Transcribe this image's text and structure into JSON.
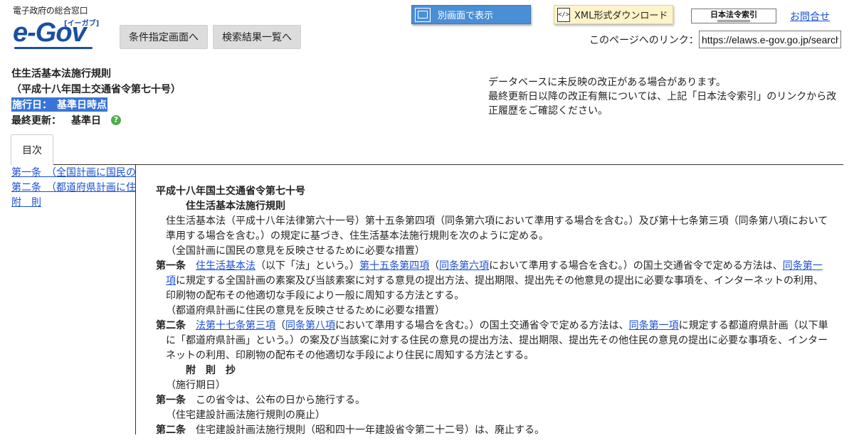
{
  "header": {
    "logo_sub": "電子政府の総合窓口",
    "logo_text": "e-Gov",
    "logo_ruby": "[イーガブ]",
    "btn_conditions": "条件指定画面へ",
    "btn_results": "検索結果一覧へ",
    "btn_popup": "別画面で表示",
    "btn_xml": "XML形式ダウンロード",
    "btn_index": "日本法令索引",
    "link_contact": "お問合せ",
    "page_link_label": "このページへのリンク：",
    "page_link_value": "https://elaws.e-gov.go.jp/search"
  },
  "law": {
    "title": "住生活基本法施行規則",
    "number": "（平成十八年国土交通省令第七十号）",
    "effective": "施行日：　基準日時点",
    "updated_label": "最終更新：",
    "updated_value": "基準日",
    "help": "?"
  },
  "notice": {
    "line1": "データベースに未反映の改正がある場合があります。",
    "line2": "最終更新日以降の改正有無については、上記「日本法令索引」のリンクから改正履歴をご確認ください。"
  },
  "tab": {
    "label": "目次"
  },
  "toc": [
    "第一条　（全国計画に国民の意見を反映させるために必要な措置）",
    "第二条　（都道府県計画に住民の意見を反映させるために必要な措置）",
    "附　則"
  ],
  "body": {
    "number": "平成十八年国土交通省令第七十号",
    "title": "住生活基本法施行規則",
    "preamble": "住生活基本法（平成十八年法律第六十一号）第十五条第四項（同条第六項において準用する場合を含む。）及び第十七条第三項（同条第八項において準用する場合を含む。）の規定に基づき、住生活基本法施行規則を次のように定める。",
    "a1_caption": "（全国計画に国民の意見を反映させるために必要な措置）",
    "a1_label": "第一条",
    "a1_link1": "住生活基本法",
    "a1_t1": "（以下「法」という。）",
    "a1_link2": "第十五条第四項",
    "a1_t2": "（",
    "a1_link3": "同条第六項",
    "a1_t3": "において準用する場合を含む。）の国土交通省令で定める方法は、",
    "a1_link4": "同条第一項",
    "a1_t4": "に規定する全国計画の素案及び当該素案に対する意見の提出方法、提出期限、提出先その他意見の提出に必要な事項を、インターネットの利用、印刷物の配布その他適切な手段により一般に周知する方法とする。",
    "a2_caption": "（都道府県計画に住民の意見を反映させるために必要な措置）",
    "a2_label": "第二条",
    "a2_link1": "法第十七条第三項",
    "a2_t1": "（",
    "a2_link2": "同条第八項",
    "a2_t2": "において準用する場合を含む。）の国土交通省令で定める方法は、",
    "a2_link3": "同条第一項",
    "a2_t3": "に規定する都道府県計画（以下単に「都道府県計画」という。）の案及び当該案に対する住民の意見の提出方法、提出期限、提出先その他住民の意見の提出に必要な事項を、インターネットの利用、印刷物の配布その他適切な手段により住民に周知する方法とする。",
    "suppl_title": "附　則　抄",
    "s1_caption": "（施行期日）",
    "s1_label": "第一条",
    "s1_text": "この省令は、公布の日から施行する。",
    "s2_caption": "（住宅建設計画法施行規則の廃止）",
    "s2_label": "第二条",
    "s2_text": "住宅建設計画法施行規則（昭和四十一年建設省令第二十二号）は、廃止する。"
  },
  "colors": {
    "link": "#1a4fd6",
    "popup_button": "#4a8fd6",
    "xml_button": "#fff3c9",
    "highlight": "#3875d7",
    "help_icon": "#4cae4c"
  }
}
